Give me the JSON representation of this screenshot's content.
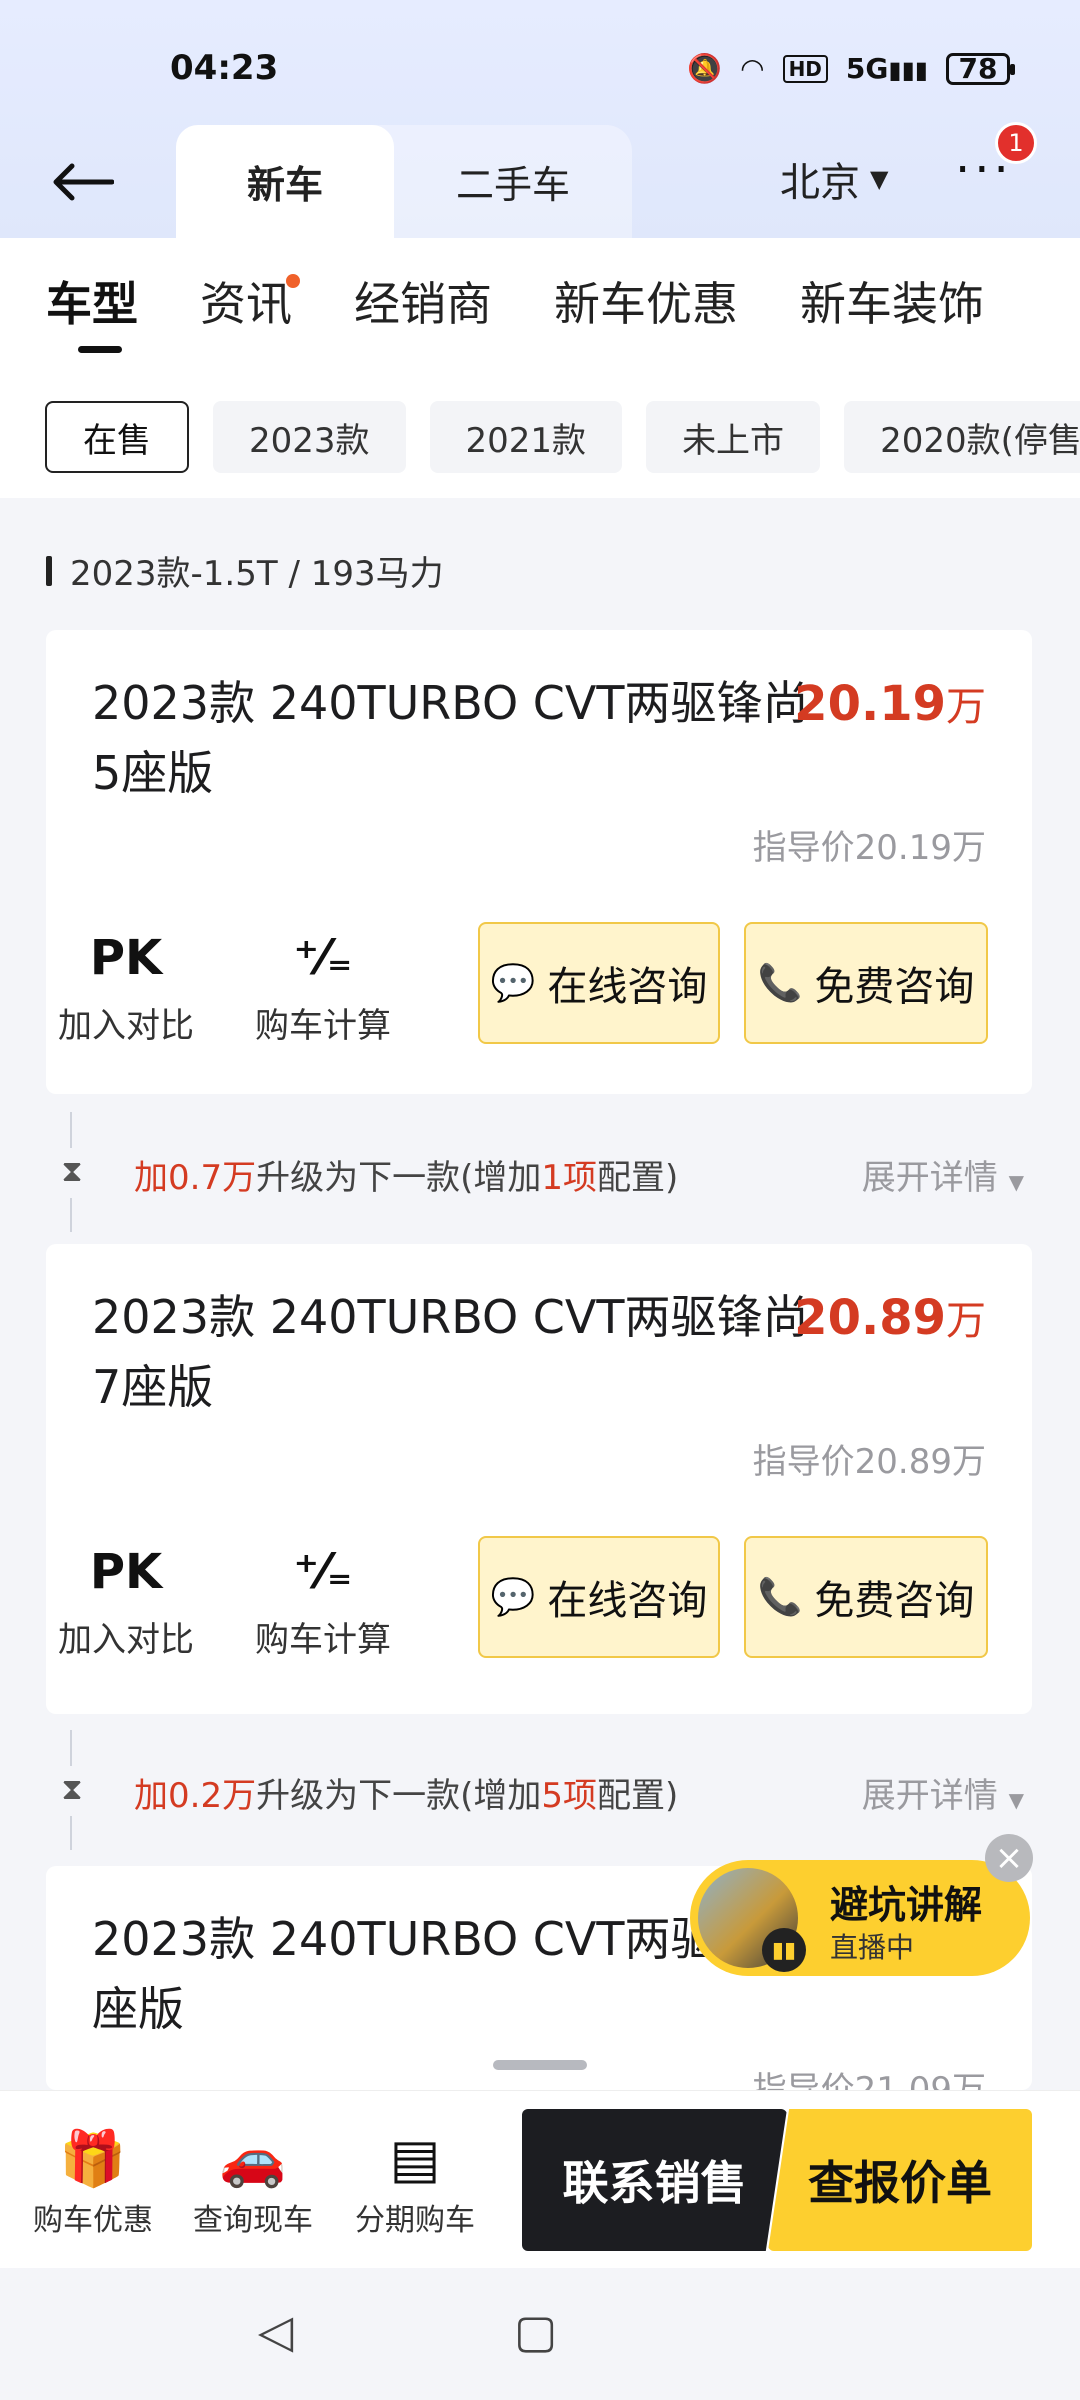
{
  "status_bar": {
    "time": "04:23",
    "network": "5G",
    "hd": "HD",
    "battery": "78"
  },
  "header": {
    "tabs": [
      {
        "label": "新车"
      },
      {
        "label": "二手车"
      }
    ],
    "city": "北京",
    "more_badge": "1"
  },
  "subnav": [
    {
      "label": "车型"
    },
    {
      "label": "资讯"
    },
    {
      "label": "经销商"
    },
    {
      "label": "新车优惠"
    },
    {
      "label": "新车装饰"
    }
  ],
  "filters": [
    {
      "label": "在售"
    },
    {
      "label": "2023款"
    },
    {
      "label": "2021款"
    },
    {
      "label": "未上市"
    },
    {
      "label": "2020款(停售)"
    }
  ],
  "section_label": "2023款-1.5T / 193马力",
  "cards": [
    {
      "title": "2023款 240TURBO CVT两驱锋尚5座版",
      "price": "20.19",
      "price_unit": "万",
      "guide_price": "指导价20.19万",
      "compare_icon": "PK",
      "compare_label": "加入对比",
      "calc_label": "购车计算",
      "consult_online": "在线咨询",
      "consult_free": "免费咨询"
    },
    {
      "title": "2023款 240TURBO CVT两驱锋尚7座版",
      "price": "20.89",
      "price_unit": "万",
      "guide_price": "指导价20.89万",
      "compare_icon": "PK",
      "compare_label": "加入对比",
      "calc_label": "购车计算",
      "consult_online": "在线咨询",
      "consult_free": "免费咨询"
    },
    {
      "title": "2023款 240TURBO CVT两驱型5座版",
      "guide_price": "指导价21.09万"
    }
  ],
  "upgrades": [
    {
      "add": "加0.7万",
      "middle": "升级为下一款(增加",
      "count": "1项",
      "tail": "配置)",
      "expand": "展开详情"
    },
    {
      "add": "加0.2万",
      "middle": "升级为下一款(增加",
      "count": "5项",
      "tail": "配置)",
      "expand": "展开详情"
    }
  ],
  "live": {
    "title": "避坑讲解",
    "status": "直播中"
  },
  "bottom": {
    "items": [
      {
        "label": "购车优惠"
      },
      {
        "label": "查询现车"
      },
      {
        "label": "分期购车"
      }
    ],
    "contact_sales": "联系销售",
    "check_price": "查报价单"
  },
  "icons": {
    "back": "arrow-left-icon",
    "gift": "gift-icon",
    "car": "car-icon",
    "list": "list-icon"
  }
}
